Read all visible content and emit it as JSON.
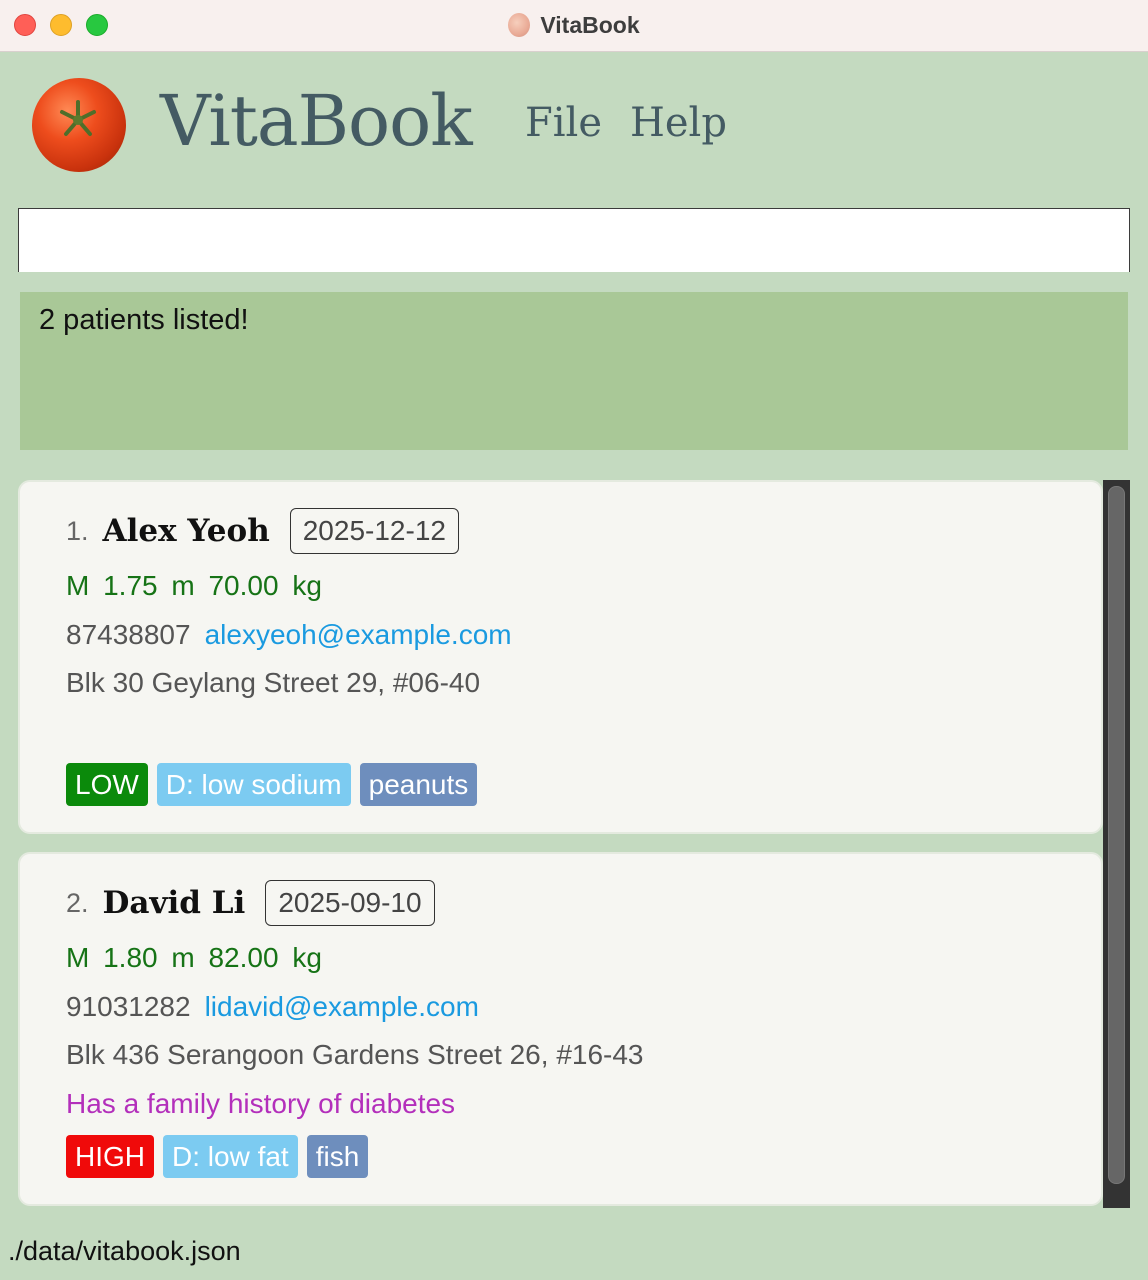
{
  "window": {
    "title": "VitaBook"
  },
  "header": {
    "app_name": "VitaBook",
    "menu": [
      "File",
      "Help"
    ]
  },
  "command_box": {
    "value": "",
    "placeholder": ""
  },
  "result_display": {
    "text": "2 patients listed!"
  },
  "patients": [
    {
      "index": "1.",
      "name": "Alex Yeoh",
      "date": "2025-12-12",
      "vitals": "M 1.75 m 70.00 kg",
      "phone": "87438807",
      "email": "alexyeoh@example.com",
      "address": "Blk 30 Geylang Street 29, #06-40",
      "note": "",
      "tags": [
        {
          "label": "LOW",
          "color": "#0b8a0b"
        },
        {
          "label": "D: low sodium",
          "color": "#7ccbf1"
        },
        {
          "label": "peanuts",
          "color": "#6e8ebd"
        }
      ]
    },
    {
      "index": "2.",
      "name": "David Li",
      "date": "2025-09-10",
      "vitals": "M 1.80 m 82.00 kg",
      "phone": "91031282",
      "email": "lidavid@example.com",
      "address": "Blk 436 Serangoon Gardens Street 26, #16-43",
      "note": "Has a family history of diabetes",
      "tags": [
        {
          "label": "HIGH",
          "color": "#f00a0a"
        },
        {
          "label": "D: low fat",
          "color": "#7ccbf1"
        },
        {
          "label": "fish",
          "color": "#6e8ebd"
        }
      ]
    }
  ],
  "status_bar": {
    "path": "./data/vitabook.json"
  },
  "colors": {
    "background": "#c4dac0",
    "result_background": "#a9c897",
    "card_background": "#f6f6f2",
    "vitals_text": "#167316",
    "email_text": "#1a9ae0",
    "note_text": "#b32fbb"
  }
}
